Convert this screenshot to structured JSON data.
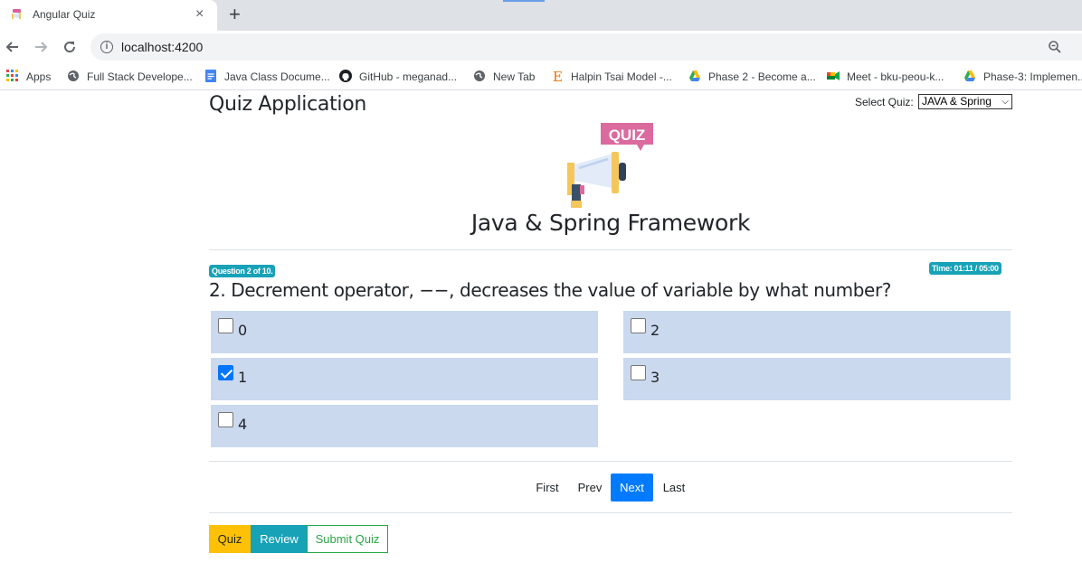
{
  "browser": {
    "tab_title": "Angular Quiz",
    "tab_close": "×",
    "new_tab": "+",
    "url": "localhost:4200",
    "bookmarks": [
      {
        "label": "Apps",
        "icon": "apps-grid-icon"
      },
      {
        "label": "Full Stack Develope...",
        "icon": "globe-icon"
      },
      {
        "label": "Java Class Docume...",
        "icon": "google-docs-icon"
      },
      {
        "label": "GitHub - meganad...",
        "icon": "github-icon"
      },
      {
        "label": "New Tab",
        "icon": "globe-icon"
      },
      {
        "label": "Halpin Tsai Model -...",
        "icon": "e-letter-icon"
      },
      {
        "label": "Phase 2 - Become a...",
        "icon": "google-drive-icon"
      },
      {
        "label": "Meet - bku-peou-k...",
        "icon": "google-meet-icon"
      },
      {
        "label": "Phase-3: Implemen...",
        "icon": "google-drive-icon"
      }
    ]
  },
  "page": {
    "app_title": "Quiz Application",
    "select_label": "Select Quiz:",
    "selected_quiz": "JAVA & Spring",
    "logo_text": "QUIZ",
    "quiz_name": "Java & Spring Framework",
    "question_badge": "Question 2 of 10.",
    "time_badge": "Time: 01:11 / 05:00",
    "question_text": "2. Decrement operator, −−, decreases the value of variable by what number?",
    "options": [
      {
        "label": "0",
        "checked": false
      },
      {
        "label": "2",
        "checked": false
      },
      {
        "label": "1",
        "checked": true
      },
      {
        "label": "3",
        "checked": false
      },
      {
        "label": "4",
        "checked": false
      }
    ],
    "pager": {
      "first": "First",
      "prev": "Prev",
      "next": "Next",
      "last": "Last"
    },
    "modes": {
      "quiz": "Quiz",
      "review": "Review",
      "submit": "Submit Quiz"
    }
  },
  "colors": {
    "option_bg": "#cad9ee",
    "primary": "#007bff",
    "info": "#17a2b8",
    "warning": "#ffc107",
    "success": "#28a745"
  }
}
